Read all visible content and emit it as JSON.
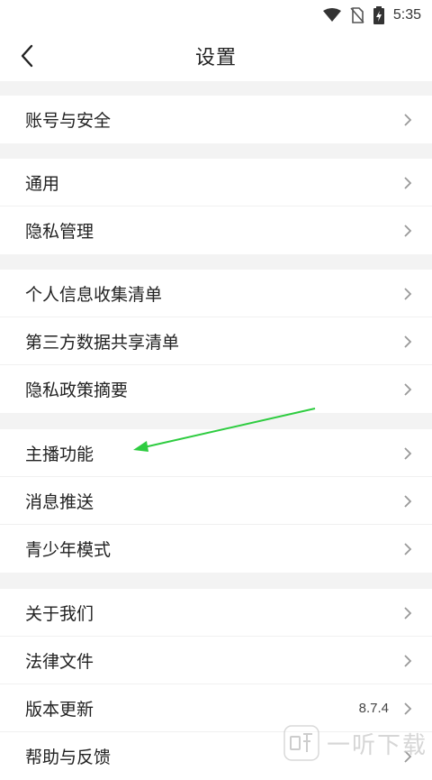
{
  "status_bar": {
    "time": "5:35",
    "icons": [
      "wifi-icon",
      "no-sim-icon",
      "battery-charging-icon"
    ]
  },
  "header": {
    "title": "设置",
    "back_icon": "chevron-left-icon"
  },
  "groups": [
    {
      "items": [
        {
          "label": "账号与安全"
        }
      ]
    },
    {
      "items": [
        {
          "label": "通用"
        },
        {
          "label": "隐私管理"
        }
      ]
    },
    {
      "items": [
        {
          "label": "个人信息收集清单"
        },
        {
          "label": "第三方数据共享清单"
        },
        {
          "label": "隐私政策摘要"
        }
      ]
    },
    {
      "items": [
        {
          "label": "主播功能"
        },
        {
          "label": "消息推送"
        },
        {
          "label": "青少年模式"
        }
      ]
    },
    {
      "items": [
        {
          "label": "关于我们"
        },
        {
          "label": "法律文件"
        },
        {
          "label": "版本更新",
          "value": "8.7.4"
        },
        {
          "label": "帮助与反馈"
        }
      ]
    }
  ],
  "annotation_arrow": {
    "color": "#2ecc40",
    "icon": "arrow-annotation-icon"
  },
  "watermark": {
    "text": "一听下载",
    "icon": "ting-logo-icon"
  }
}
